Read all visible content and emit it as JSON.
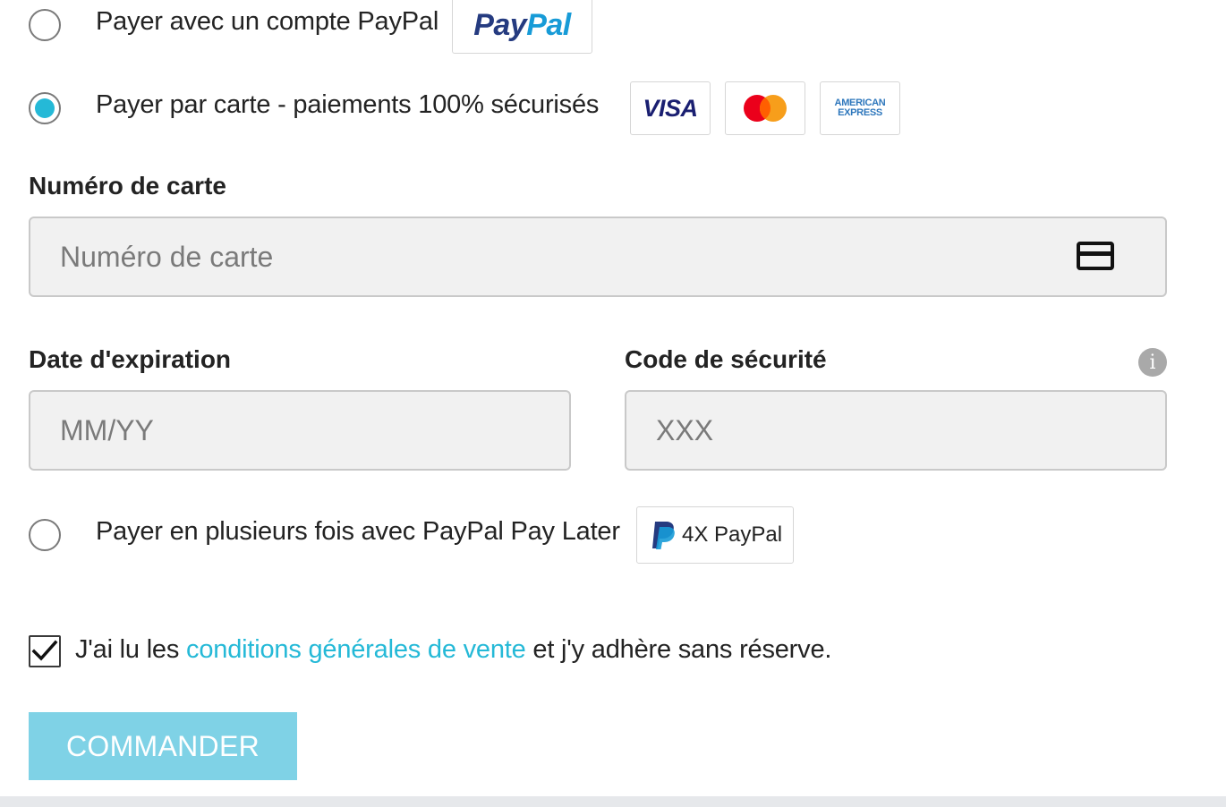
{
  "payment_options": [
    {
      "label": "Payer avec un compte PayPal",
      "selected": false
    },
    {
      "label": "Payer par carte - paiements 100% sécurisés",
      "selected": true
    },
    {
      "label": "Payer en plusieurs fois avec PayPal Pay Later",
      "selected": false
    }
  ],
  "logos": {
    "paypal_pay": "Pay",
    "paypal_pal": "Pal",
    "visa": "VISA",
    "amex_line1": "AMERICAN",
    "amex_line2": "EXPRESS",
    "paylater": "4X PayPal"
  },
  "card_form": {
    "card_number_label": "Numéro de carte",
    "card_number_placeholder": "Numéro de carte",
    "card_number_value": "",
    "expiry_label": "Date d'expiration",
    "expiry_placeholder": "MM/YY",
    "expiry_value": "",
    "cvv_label": "Code de sécurité",
    "cvv_placeholder": "XXX",
    "cvv_value": "",
    "info_symbol": "i"
  },
  "terms": {
    "checked": true,
    "prefix": "J'ai lu les ",
    "link": "conditions générales de vente",
    "suffix": " et j'y adhère sans réserve."
  },
  "submit_label": "COMMANDER",
  "colors": {
    "accent": "#25b9d7",
    "button_bg": "#7fd2e6",
    "paypal_dark": "#253b80",
    "paypal_light": "#179bd7",
    "visa_blue": "#1a1f71",
    "mastercard_red": "#eb001b",
    "mastercard_orange": "#f79e1b",
    "amex_blue": "#2e77bc"
  }
}
